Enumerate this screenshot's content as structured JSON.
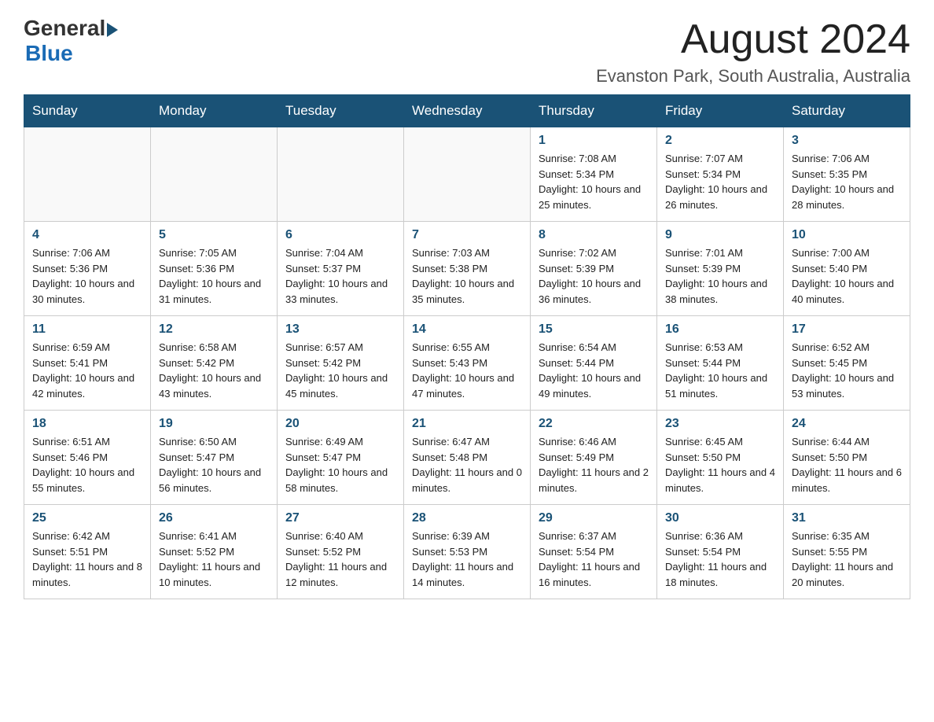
{
  "header": {
    "logo_general": "General",
    "logo_blue": "Blue",
    "month_title": "August 2024",
    "location": "Evanston Park, South Australia, Australia"
  },
  "days_of_week": [
    "Sunday",
    "Monday",
    "Tuesday",
    "Wednesday",
    "Thursday",
    "Friday",
    "Saturday"
  ],
  "weeks": [
    [
      {
        "day": "",
        "sunrise": "",
        "sunset": "",
        "daylight": ""
      },
      {
        "day": "",
        "sunrise": "",
        "sunset": "",
        "daylight": ""
      },
      {
        "day": "",
        "sunrise": "",
        "sunset": "",
        "daylight": ""
      },
      {
        "day": "",
        "sunrise": "",
        "sunset": "",
        "daylight": ""
      },
      {
        "day": "1",
        "sunrise": "Sunrise: 7:08 AM",
        "sunset": "Sunset: 5:34 PM",
        "daylight": "Daylight: 10 hours and 25 minutes."
      },
      {
        "day": "2",
        "sunrise": "Sunrise: 7:07 AM",
        "sunset": "Sunset: 5:34 PM",
        "daylight": "Daylight: 10 hours and 26 minutes."
      },
      {
        "day": "3",
        "sunrise": "Sunrise: 7:06 AM",
        "sunset": "Sunset: 5:35 PM",
        "daylight": "Daylight: 10 hours and 28 minutes."
      }
    ],
    [
      {
        "day": "4",
        "sunrise": "Sunrise: 7:06 AM",
        "sunset": "Sunset: 5:36 PM",
        "daylight": "Daylight: 10 hours and 30 minutes."
      },
      {
        "day": "5",
        "sunrise": "Sunrise: 7:05 AM",
        "sunset": "Sunset: 5:36 PM",
        "daylight": "Daylight: 10 hours and 31 minutes."
      },
      {
        "day": "6",
        "sunrise": "Sunrise: 7:04 AM",
        "sunset": "Sunset: 5:37 PM",
        "daylight": "Daylight: 10 hours and 33 minutes."
      },
      {
        "day": "7",
        "sunrise": "Sunrise: 7:03 AM",
        "sunset": "Sunset: 5:38 PM",
        "daylight": "Daylight: 10 hours and 35 minutes."
      },
      {
        "day": "8",
        "sunrise": "Sunrise: 7:02 AM",
        "sunset": "Sunset: 5:39 PM",
        "daylight": "Daylight: 10 hours and 36 minutes."
      },
      {
        "day": "9",
        "sunrise": "Sunrise: 7:01 AM",
        "sunset": "Sunset: 5:39 PM",
        "daylight": "Daylight: 10 hours and 38 minutes."
      },
      {
        "day": "10",
        "sunrise": "Sunrise: 7:00 AM",
        "sunset": "Sunset: 5:40 PM",
        "daylight": "Daylight: 10 hours and 40 minutes."
      }
    ],
    [
      {
        "day": "11",
        "sunrise": "Sunrise: 6:59 AM",
        "sunset": "Sunset: 5:41 PM",
        "daylight": "Daylight: 10 hours and 42 minutes."
      },
      {
        "day": "12",
        "sunrise": "Sunrise: 6:58 AM",
        "sunset": "Sunset: 5:42 PM",
        "daylight": "Daylight: 10 hours and 43 minutes."
      },
      {
        "day": "13",
        "sunrise": "Sunrise: 6:57 AM",
        "sunset": "Sunset: 5:42 PM",
        "daylight": "Daylight: 10 hours and 45 minutes."
      },
      {
        "day": "14",
        "sunrise": "Sunrise: 6:55 AM",
        "sunset": "Sunset: 5:43 PM",
        "daylight": "Daylight: 10 hours and 47 minutes."
      },
      {
        "day": "15",
        "sunrise": "Sunrise: 6:54 AM",
        "sunset": "Sunset: 5:44 PM",
        "daylight": "Daylight: 10 hours and 49 minutes."
      },
      {
        "day": "16",
        "sunrise": "Sunrise: 6:53 AM",
        "sunset": "Sunset: 5:44 PM",
        "daylight": "Daylight: 10 hours and 51 minutes."
      },
      {
        "day": "17",
        "sunrise": "Sunrise: 6:52 AM",
        "sunset": "Sunset: 5:45 PM",
        "daylight": "Daylight: 10 hours and 53 minutes."
      }
    ],
    [
      {
        "day": "18",
        "sunrise": "Sunrise: 6:51 AM",
        "sunset": "Sunset: 5:46 PM",
        "daylight": "Daylight: 10 hours and 55 minutes."
      },
      {
        "day": "19",
        "sunrise": "Sunrise: 6:50 AM",
        "sunset": "Sunset: 5:47 PM",
        "daylight": "Daylight: 10 hours and 56 minutes."
      },
      {
        "day": "20",
        "sunrise": "Sunrise: 6:49 AM",
        "sunset": "Sunset: 5:47 PM",
        "daylight": "Daylight: 10 hours and 58 minutes."
      },
      {
        "day": "21",
        "sunrise": "Sunrise: 6:47 AM",
        "sunset": "Sunset: 5:48 PM",
        "daylight": "Daylight: 11 hours and 0 minutes."
      },
      {
        "day": "22",
        "sunrise": "Sunrise: 6:46 AM",
        "sunset": "Sunset: 5:49 PM",
        "daylight": "Daylight: 11 hours and 2 minutes."
      },
      {
        "day": "23",
        "sunrise": "Sunrise: 6:45 AM",
        "sunset": "Sunset: 5:50 PM",
        "daylight": "Daylight: 11 hours and 4 minutes."
      },
      {
        "day": "24",
        "sunrise": "Sunrise: 6:44 AM",
        "sunset": "Sunset: 5:50 PM",
        "daylight": "Daylight: 11 hours and 6 minutes."
      }
    ],
    [
      {
        "day": "25",
        "sunrise": "Sunrise: 6:42 AM",
        "sunset": "Sunset: 5:51 PM",
        "daylight": "Daylight: 11 hours and 8 minutes."
      },
      {
        "day": "26",
        "sunrise": "Sunrise: 6:41 AM",
        "sunset": "Sunset: 5:52 PM",
        "daylight": "Daylight: 11 hours and 10 minutes."
      },
      {
        "day": "27",
        "sunrise": "Sunrise: 6:40 AM",
        "sunset": "Sunset: 5:52 PM",
        "daylight": "Daylight: 11 hours and 12 minutes."
      },
      {
        "day": "28",
        "sunrise": "Sunrise: 6:39 AM",
        "sunset": "Sunset: 5:53 PM",
        "daylight": "Daylight: 11 hours and 14 minutes."
      },
      {
        "day": "29",
        "sunrise": "Sunrise: 6:37 AM",
        "sunset": "Sunset: 5:54 PM",
        "daylight": "Daylight: 11 hours and 16 minutes."
      },
      {
        "day": "30",
        "sunrise": "Sunrise: 6:36 AM",
        "sunset": "Sunset: 5:54 PM",
        "daylight": "Daylight: 11 hours and 18 minutes."
      },
      {
        "day": "31",
        "sunrise": "Sunrise: 6:35 AM",
        "sunset": "Sunset: 5:55 PM",
        "daylight": "Daylight: 11 hours and 20 minutes."
      }
    ]
  ]
}
